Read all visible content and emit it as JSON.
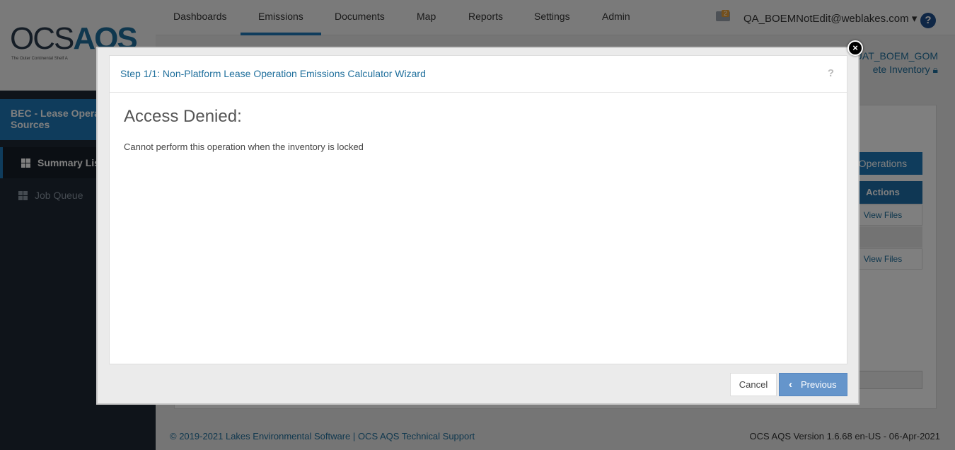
{
  "app": {
    "logo_main": "OCS",
    "logo_accent": "AQS",
    "logo_tagline": "The Outer Continental Shelf A"
  },
  "nav": {
    "tabs": [
      "Dashboards",
      "Emissions",
      "Documents",
      "Map",
      "Reports",
      "Settings",
      "Admin"
    ],
    "active": "Emissions",
    "mail_count": "2",
    "user": "QA_BOEMNotEdit@weblakes.com",
    "help": "?"
  },
  "facility": {
    "line1": "UAT_BOEM_GOM",
    "line2": "ete Inventory"
  },
  "sidebar": {
    "context": "BEC - Lease Operations Sources",
    "items": [
      {
        "label": "Summary List"
      },
      {
        "label": "Job Queue"
      }
    ]
  },
  "background": {
    "action_button": "e Operations",
    "actions_header": "Actions",
    "row_link": "View Files"
  },
  "modal": {
    "title": "Step 1/1: Non-Platform Lease Operation Emissions Calculator Wizard",
    "help": "?",
    "heading": "Access Denied:",
    "message": "Cannot perform this operation when the inventory is locked",
    "cancel_label": "Cancel",
    "previous_label": "Previous",
    "close": "×"
  },
  "footer": {
    "copyright": "© 2019-2021 Lakes Environmental Software",
    "separator": "|",
    "support": "OCS AQS Technical Support",
    "version": "OCS AQS Version 1.6.68 en-US - 06-Apr-2021"
  }
}
